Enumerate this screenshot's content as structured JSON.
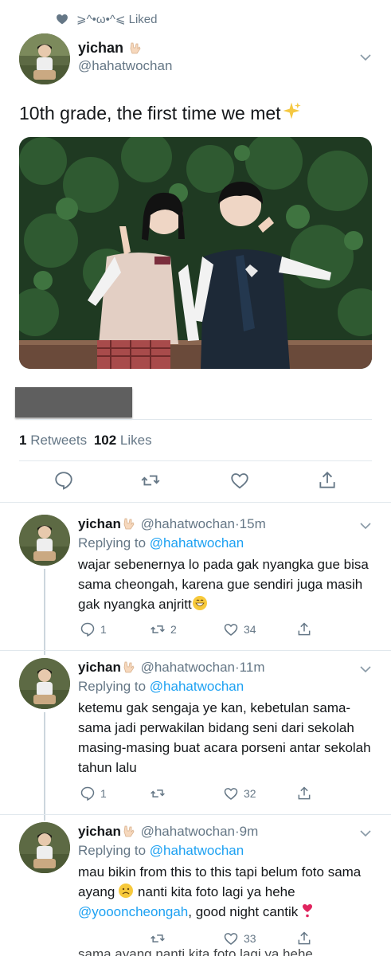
{
  "liked_banner": {
    "icon": "heart-icon",
    "text": "⩾^•ω•^⩽ Liked"
  },
  "tweet": {
    "display_name": "yichan",
    "handle": "@hahatwochan",
    "text": "10th grade, the first time we met",
    "emoji": "sparkles",
    "retweets_count": "1",
    "retweets_label": "Retweets",
    "likes_count": "102",
    "likes_label": "Likes",
    "actions": [
      "reply-icon",
      "retweet-icon",
      "like-icon",
      "share-icon"
    ]
  },
  "replies": [
    {
      "display_name": "yichan",
      "handle": "@hahatwochan",
      "time": "15m",
      "replying_label": "Replying to",
      "replying_to": "@hahatwochan",
      "body": "wajar sebenernya lo pada gak nyangka gue bisa sama cheongah, karena gue sendiri juga masih gak nyangka anjritt",
      "reply_count": "1",
      "retweet_count": "2",
      "like_count": "34"
    },
    {
      "display_name": "yichan",
      "handle": "@hahatwochan",
      "time": "11m",
      "replying_label": "Replying to",
      "replying_to": "@hahatwochan",
      "body": "ketemu gak sengaja ye kan, kebetulan sama-sama jadi perwakilan bidang seni dari sekolah masing-masing buat acara porseni antar sekolah tahun lalu",
      "reply_count": "1",
      "retweet_count": "",
      "like_count": "32"
    },
    {
      "display_name": "yichan",
      "handle": "@hahatwochan",
      "time": "9m",
      "replying_label": "Replying to",
      "replying_to": "@hahatwochan",
      "body_part1": "mau bikin from this to this tapi belum foto sama ayang",
      "body_part2": " nanti kita foto lagi ya hehe",
      "mention": "@yoooncheongah",
      "body_part3": ", good night cantik",
      "reply_count": "",
      "retweet_count": "",
      "like_count": "33"
    }
  ],
  "cutoff_text": "sama ayang  nanti kita foto lagi ya hehe",
  "colors": {
    "accent": "#1da1f2",
    "muted": "#657786",
    "text": "#14171a",
    "divider": "#e1e8ed"
  }
}
